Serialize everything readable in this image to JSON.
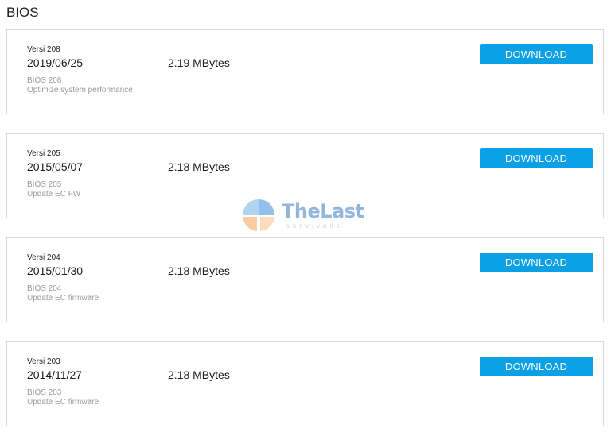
{
  "page": {
    "title": "BIOS"
  },
  "downloads": [
    {
      "version": "Versi 208",
      "date": "2019/06/25",
      "size": "2.19 MBytes",
      "bios": "BIOS 208",
      "description": "Optimize system performance",
      "button": "DOWNLOAD"
    },
    {
      "version": "Versi 205",
      "date": "2015/05/07",
      "size": "2.18 MBytes",
      "bios": "BIOS 205",
      "description": "Update EC FW",
      "button": "DOWNLOAD"
    },
    {
      "version": "Versi 204",
      "date": "2015/01/30",
      "size": "2.18 MBytes",
      "bios": "BIOS 204",
      "description": "Update EC firmware",
      "button": "DOWNLOAD"
    },
    {
      "version": "Versi 203",
      "date": "2014/11/27",
      "size": "2.18 MBytes",
      "bios": "BIOS 203",
      "description": "Update EC firmware",
      "button": "DOWNLOAD"
    }
  ],
  "watermark": {
    "name": "TheLast",
    "tagline": "SURVIVORS",
    "icon": "thelast-logo-icon"
  },
  "colors": {
    "button": "#0aa0e6",
    "muted_text": "#9a9a9a",
    "border": "#d8d8d8"
  }
}
